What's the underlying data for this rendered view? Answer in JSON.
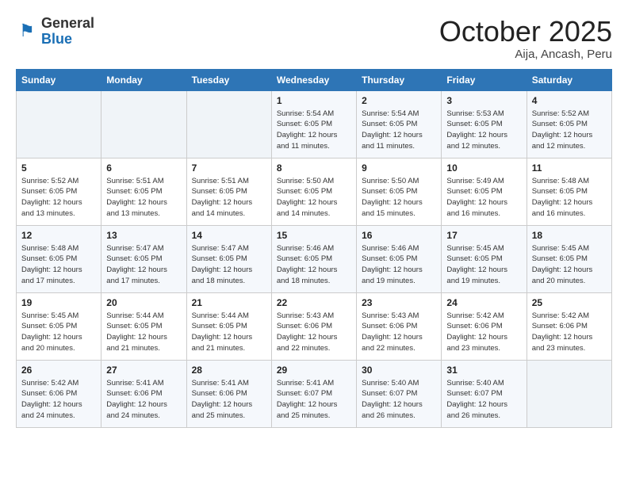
{
  "header": {
    "logo_general": "General",
    "logo_blue": "Blue",
    "month": "October 2025",
    "location": "Aija, Ancash, Peru"
  },
  "weekdays": [
    "Sunday",
    "Monday",
    "Tuesday",
    "Wednesday",
    "Thursday",
    "Friday",
    "Saturday"
  ],
  "weeks": [
    [
      {
        "day": "",
        "info": ""
      },
      {
        "day": "",
        "info": ""
      },
      {
        "day": "",
        "info": ""
      },
      {
        "day": "1",
        "info": "Sunrise: 5:54 AM\nSunset: 6:05 PM\nDaylight: 12 hours\nand 11 minutes."
      },
      {
        "day": "2",
        "info": "Sunrise: 5:54 AM\nSunset: 6:05 PM\nDaylight: 12 hours\nand 11 minutes."
      },
      {
        "day": "3",
        "info": "Sunrise: 5:53 AM\nSunset: 6:05 PM\nDaylight: 12 hours\nand 12 minutes."
      },
      {
        "day": "4",
        "info": "Sunrise: 5:52 AM\nSunset: 6:05 PM\nDaylight: 12 hours\nand 12 minutes."
      }
    ],
    [
      {
        "day": "5",
        "info": "Sunrise: 5:52 AM\nSunset: 6:05 PM\nDaylight: 12 hours\nand 13 minutes."
      },
      {
        "day": "6",
        "info": "Sunrise: 5:51 AM\nSunset: 6:05 PM\nDaylight: 12 hours\nand 13 minutes."
      },
      {
        "day": "7",
        "info": "Sunrise: 5:51 AM\nSunset: 6:05 PM\nDaylight: 12 hours\nand 14 minutes."
      },
      {
        "day": "8",
        "info": "Sunrise: 5:50 AM\nSunset: 6:05 PM\nDaylight: 12 hours\nand 14 minutes."
      },
      {
        "day": "9",
        "info": "Sunrise: 5:50 AM\nSunset: 6:05 PM\nDaylight: 12 hours\nand 15 minutes."
      },
      {
        "day": "10",
        "info": "Sunrise: 5:49 AM\nSunset: 6:05 PM\nDaylight: 12 hours\nand 16 minutes."
      },
      {
        "day": "11",
        "info": "Sunrise: 5:48 AM\nSunset: 6:05 PM\nDaylight: 12 hours\nand 16 minutes."
      }
    ],
    [
      {
        "day": "12",
        "info": "Sunrise: 5:48 AM\nSunset: 6:05 PM\nDaylight: 12 hours\nand 17 minutes."
      },
      {
        "day": "13",
        "info": "Sunrise: 5:47 AM\nSunset: 6:05 PM\nDaylight: 12 hours\nand 17 minutes."
      },
      {
        "day": "14",
        "info": "Sunrise: 5:47 AM\nSunset: 6:05 PM\nDaylight: 12 hours\nand 18 minutes."
      },
      {
        "day": "15",
        "info": "Sunrise: 5:46 AM\nSunset: 6:05 PM\nDaylight: 12 hours\nand 18 minutes."
      },
      {
        "day": "16",
        "info": "Sunrise: 5:46 AM\nSunset: 6:05 PM\nDaylight: 12 hours\nand 19 minutes."
      },
      {
        "day": "17",
        "info": "Sunrise: 5:45 AM\nSunset: 6:05 PM\nDaylight: 12 hours\nand 19 minutes."
      },
      {
        "day": "18",
        "info": "Sunrise: 5:45 AM\nSunset: 6:05 PM\nDaylight: 12 hours\nand 20 minutes."
      }
    ],
    [
      {
        "day": "19",
        "info": "Sunrise: 5:45 AM\nSunset: 6:05 PM\nDaylight: 12 hours\nand 20 minutes."
      },
      {
        "day": "20",
        "info": "Sunrise: 5:44 AM\nSunset: 6:05 PM\nDaylight: 12 hours\nand 21 minutes."
      },
      {
        "day": "21",
        "info": "Sunrise: 5:44 AM\nSunset: 6:05 PM\nDaylight: 12 hours\nand 21 minutes."
      },
      {
        "day": "22",
        "info": "Sunrise: 5:43 AM\nSunset: 6:06 PM\nDaylight: 12 hours\nand 22 minutes."
      },
      {
        "day": "23",
        "info": "Sunrise: 5:43 AM\nSunset: 6:06 PM\nDaylight: 12 hours\nand 22 minutes."
      },
      {
        "day": "24",
        "info": "Sunrise: 5:42 AM\nSunset: 6:06 PM\nDaylight: 12 hours\nand 23 minutes."
      },
      {
        "day": "25",
        "info": "Sunrise: 5:42 AM\nSunset: 6:06 PM\nDaylight: 12 hours\nand 23 minutes."
      }
    ],
    [
      {
        "day": "26",
        "info": "Sunrise: 5:42 AM\nSunset: 6:06 PM\nDaylight: 12 hours\nand 24 minutes."
      },
      {
        "day": "27",
        "info": "Sunrise: 5:41 AM\nSunset: 6:06 PM\nDaylight: 12 hours\nand 24 minutes."
      },
      {
        "day": "28",
        "info": "Sunrise: 5:41 AM\nSunset: 6:06 PM\nDaylight: 12 hours\nand 25 minutes."
      },
      {
        "day": "29",
        "info": "Sunrise: 5:41 AM\nSunset: 6:07 PM\nDaylight: 12 hours\nand 25 minutes."
      },
      {
        "day": "30",
        "info": "Sunrise: 5:40 AM\nSunset: 6:07 PM\nDaylight: 12 hours\nand 26 minutes."
      },
      {
        "day": "31",
        "info": "Sunrise: 5:40 AM\nSunset: 6:07 PM\nDaylight: 12 hours\nand 26 minutes."
      },
      {
        "day": "",
        "info": ""
      }
    ]
  ]
}
